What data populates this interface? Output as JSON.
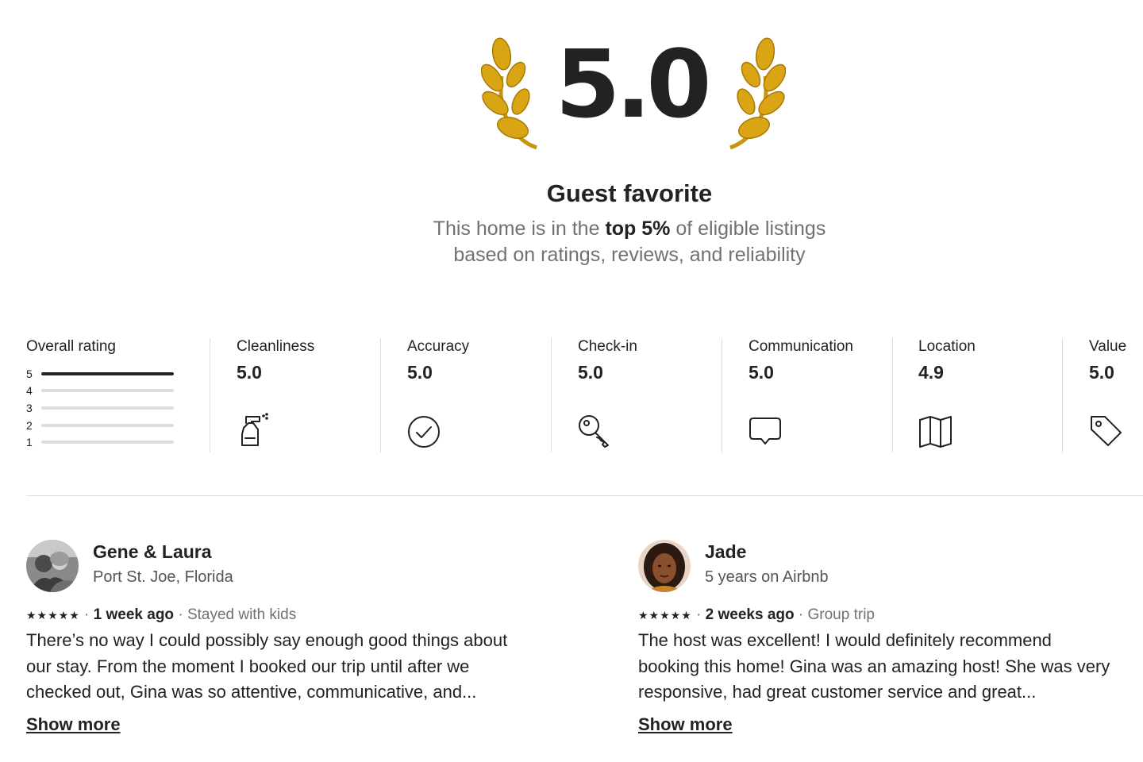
{
  "hero": {
    "score": "5.0",
    "title": "Guest favorite",
    "subtitle_pre": "This home is in the ",
    "subtitle_bold": "top 5%",
    "subtitle_post": " of eligible listings",
    "subtitle_line2": "based on ratings, reviews, and reliability",
    "laurel_color": "#d9a514"
  },
  "overall": {
    "label": "Overall rating",
    "rows": [
      {
        "star": "5",
        "fraction": 1.0
      },
      {
        "star": "4",
        "fraction": 0.0
      },
      {
        "star": "3",
        "fraction": 0.0
      },
      {
        "star": "2",
        "fraction": 0.0
      },
      {
        "star": "1",
        "fraction": 0.0
      }
    ]
  },
  "categories": [
    {
      "label": "Cleanliness",
      "value": "5.0",
      "icon": "spray-bottle-icon"
    },
    {
      "label": "Accuracy",
      "value": "5.0",
      "icon": "check-circle-icon"
    },
    {
      "label": "Check-in",
      "value": "5.0",
      "icon": "key-icon"
    },
    {
      "label": "Communication",
      "value": "5.0",
      "icon": "chat-bubble-icon"
    },
    {
      "label": "Location",
      "value": "4.9",
      "icon": "map-icon"
    },
    {
      "label": "Value",
      "value": "5.0",
      "icon": "price-tag-icon"
    }
  ],
  "reviews": [
    {
      "name": "Gene & Laura",
      "meta": "Port St. Joe, Florida",
      "stars": "★★★★★",
      "when": "1 week ago",
      "trip": "Stayed with kids",
      "text_lines": [
        "There’s no way I could possibly say enough good things about",
        "our stay. From the moment I booked our trip until after we",
        "checked out, Gina was so attentive, communicative, and..."
      ],
      "show_more": "Show more"
    },
    {
      "name": "Jade",
      "meta": "5 years on Airbnb",
      "stars": "★★★★★",
      "when": "2 weeks ago",
      "trip": "Group trip",
      "text_lines": [
        "The host was excellent! I would definitely recommend",
        "booking this home! Gina was an amazing host! She was very",
        "responsive, had great customer service and great..."
      ],
      "show_more": "Show more"
    }
  ],
  "sep": "·"
}
